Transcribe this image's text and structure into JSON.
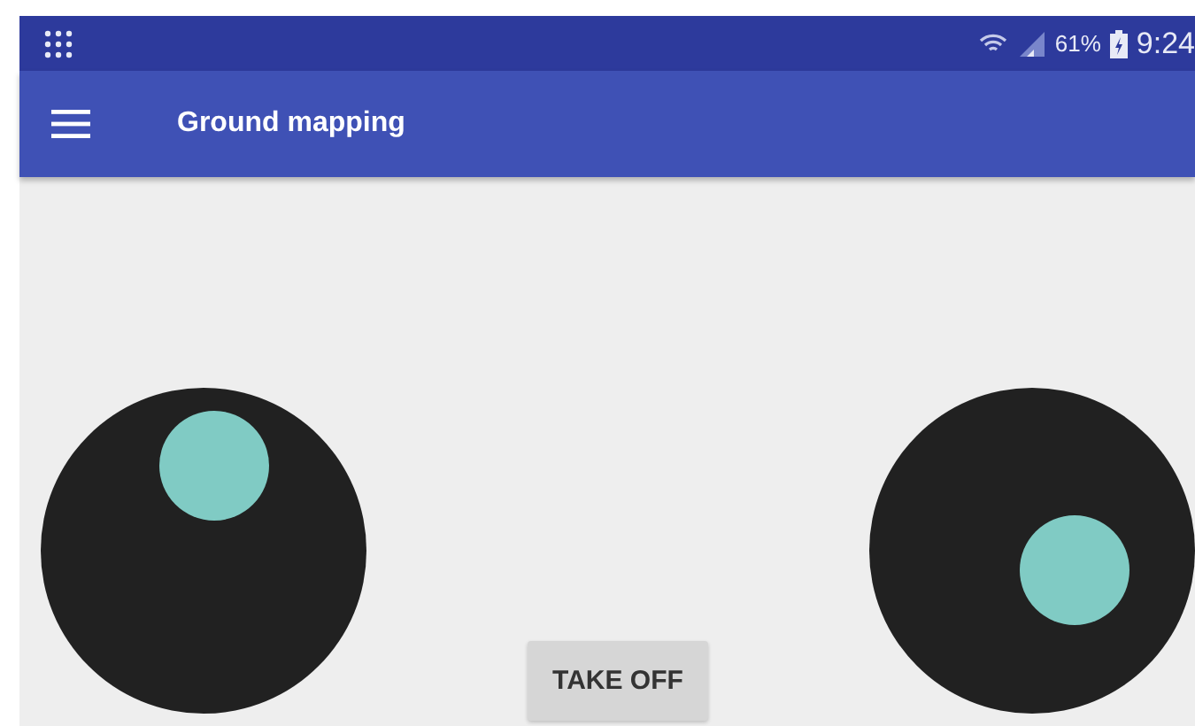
{
  "status_bar": {
    "battery": "61%",
    "time": "9:24"
  },
  "app_bar": {
    "title": "Ground mapping"
  },
  "controls": {
    "button": "TAKE OFF"
  }
}
